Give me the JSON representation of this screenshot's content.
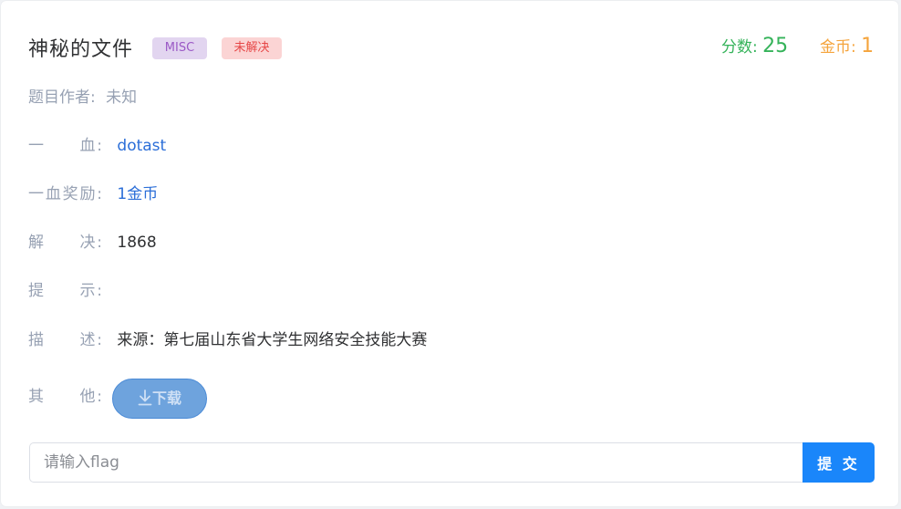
{
  "challenge": {
    "title": "神秘的文件",
    "category_tag": "MISC",
    "status_tag": "未解决",
    "score_label": "分数:",
    "score_value": "25",
    "coins_label": "金币:",
    "coins_value": "1"
  },
  "details": {
    "author_label": "题目作者:",
    "author_value": "未知",
    "first_blood_label": "一　　血:",
    "first_blood_value": "dotast",
    "first_blood_reward_label": "一血奖励:",
    "first_blood_reward_value": "1金币",
    "solves_label": "解　　决:",
    "solves_value": "1868",
    "hint_label": "提　　示:",
    "hint_value": "",
    "description_label": "描　　述:",
    "description_value": "来源：第七届山东省大学生网络安全技能大赛",
    "other_label": "其　　他:",
    "download_label": "下载"
  },
  "submit": {
    "placeholder": "请输入flag",
    "button_label": "提 交"
  },
  "colors": {
    "score": "#35b35a",
    "coins": "#f5a43c",
    "link_blue": "#2b6ed8",
    "submit_bg": "#1a86fa",
    "misc_tag_bg": "#e2d5f0",
    "status_tag_bg": "#fbd4d4"
  },
  "icons": {
    "download": "download-arrow-icon"
  }
}
